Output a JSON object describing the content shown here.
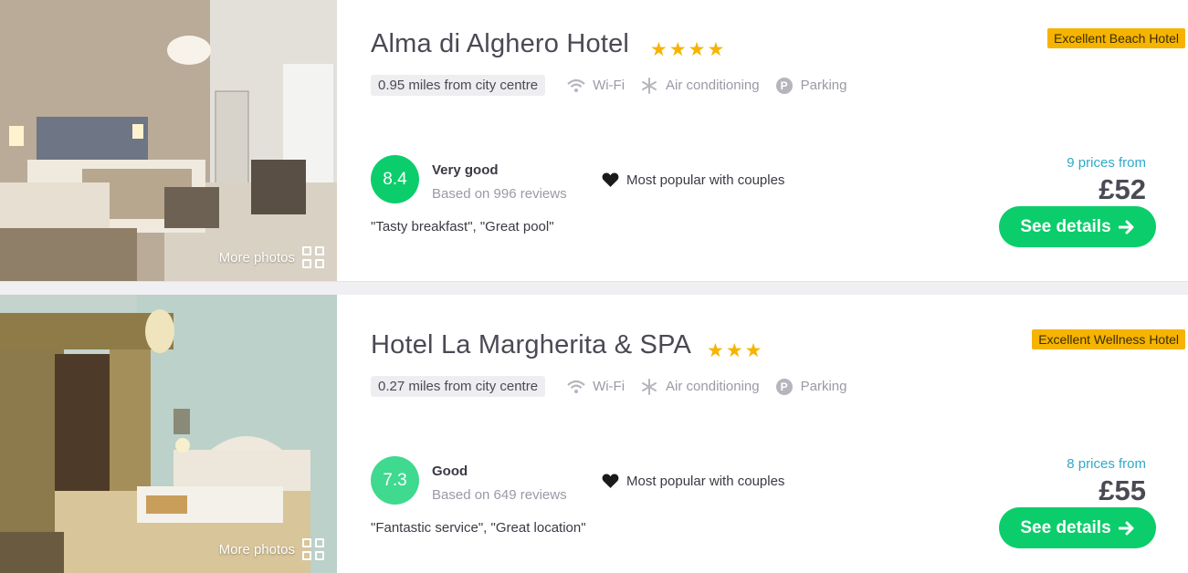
{
  "hotels": [
    {
      "name": "Alma di Alghero Hotel",
      "stars": "★★★★",
      "star_count": 4,
      "badge": "Excellent Beach Hotel",
      "distance": "0.95 miles from city centre",
      "amenities": [
        "Wi-Fi",
        "Air conditioning",
        "Parking"
      ],
      "score": "8.4",
      "score_color": "#0ccd6b",
      "rating_label": "Very good",
      "reviews": "Based on 996 reviews",
      "popular": "Most popular with couples",
      "quotes": "\"Tasty breakfast\", \"Great pool\"",
      "prices_from": "9 prices from",
      "price": "£52",
      "button": "See details",
      "more_photos": "More photos"
    },
    {
      "name": "Hotel La Margherita & SPA",
      "stars": "★★★",
      "star_count": 3,
      "badge": "Excellent Wellness Hotel",
      "distance": "0.27 miles from city centre",
      "amenities": [
        "Wi-Fi",
        "Air conditioning",
        "Parking"
      ],
      "score": "7.3",
      "score_color": "#3fd98f",
      "rating_label": "Good",
      "reviews": "Based on 649 reviews",
      "popular": "Most popular with couples",
      "quotes": "\"Fantastic service\", \"Great location\"",
      "prices_from": "8 prices from",
      "price": "£55",
      "button": "See details",
      "more_photos": "More photos"
    }
  ],
  "icons": {
    "wifi": "wifi-icon",
    "ac": "snowflake-icon",
    "parking": "parking-icon",
    "heart": "heart-icon",
    "arrow": "arrow-right-icon",
    "grid": "grid-icon"
  },
  "colors": {
    "accent_green": "#0ccd6b",
    "badge_yellow": "#f6b400",
    "price_from_blue": "#2ea9c7"
  }
}
